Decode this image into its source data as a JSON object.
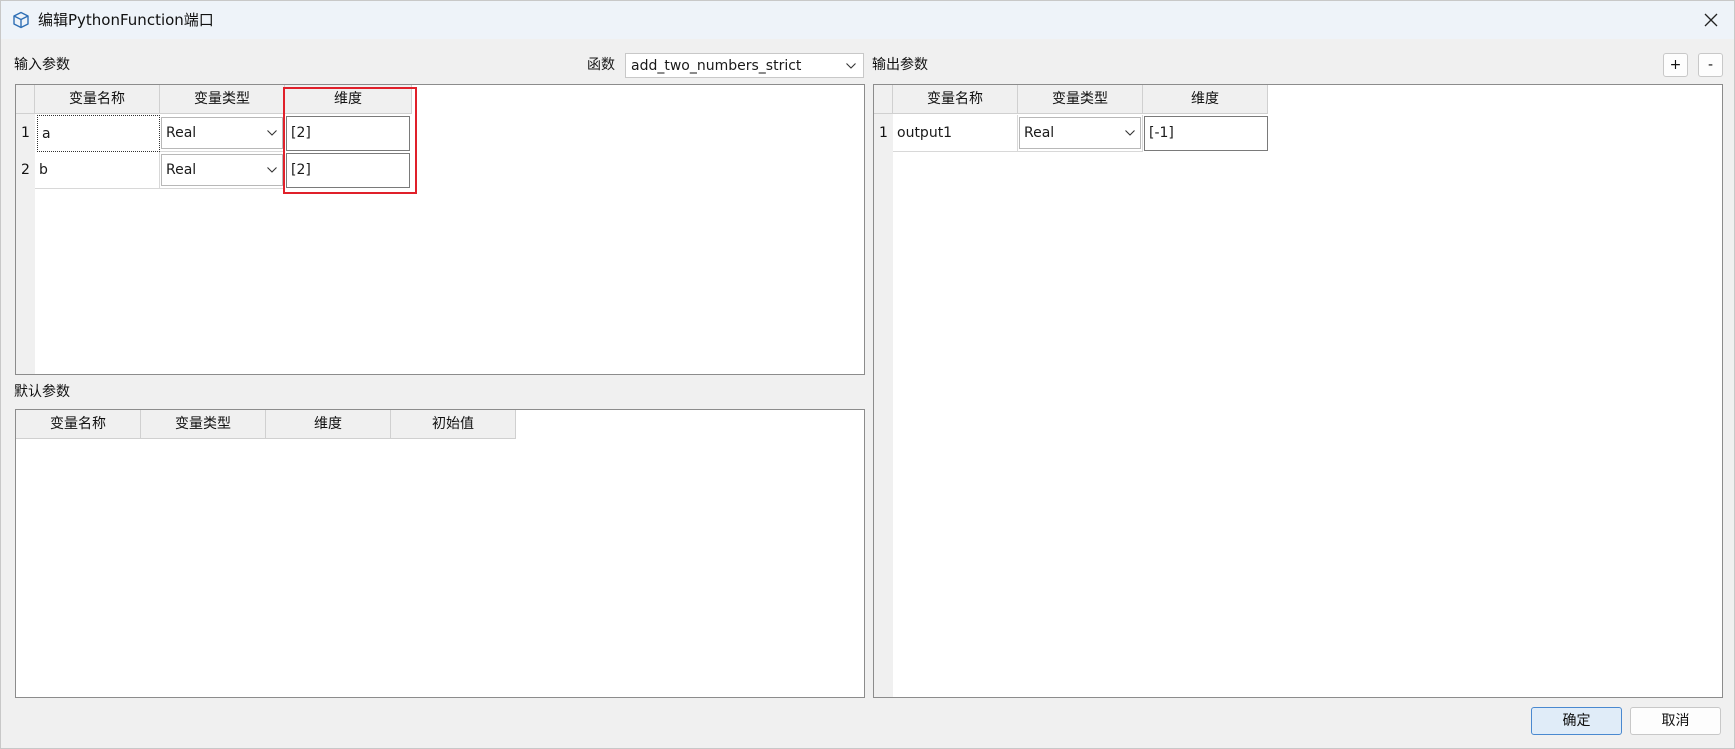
{
  "window": {
    "title": "编辑PythonFunction端口"
  },
  "input": {
    "section_label": "输入参数",
    "headers": [
      "变量名称",
      "变量类型",
      "维度"
    ],
    "rows": [
      {
        "num": "1",
        "name": "a",
        "type": "Real",
        "dim": "[2]"
      },
      {
        "num": "2",
        "name": "b",
        "type": "Real",
        "dim": "[2]"
      }
    ]
  },
  "function": {
    "label": "函数",
    "selected": "add_two_numbers_strict"
  },
  "output": {
    "section_label": "输出参数",
    "add_label": "+",
    "remove_label": "-",
    "headers": [
      "变量名称",
      "变量类型",
      "维度"
    ],
    "rows": [
      {
        "num": "1",
        "name": "output1",
        "type": "Real",
        "dim": "[-1]"
      }
    ]
  },
  "defaults": {
    "section_label": "默认参数",
    "headers": [
      "变量名称",
      "变量类型",
      "维度",
      "初始值"
    ]
  },
  "footer": {
    "ok_label": "确定",
    "cancel_label": "取消"
  },
  "colors": {
    "highlight": "#e0202a",
    "primary_button_border": "#4a89d0",
    "primary_button_bg": "#e0ecf8"
  },
  "icons": {
    "app": "cube-icon",
    "close": "close-icon",
    "dropdown": "chevron-down-icon"
  }
}
